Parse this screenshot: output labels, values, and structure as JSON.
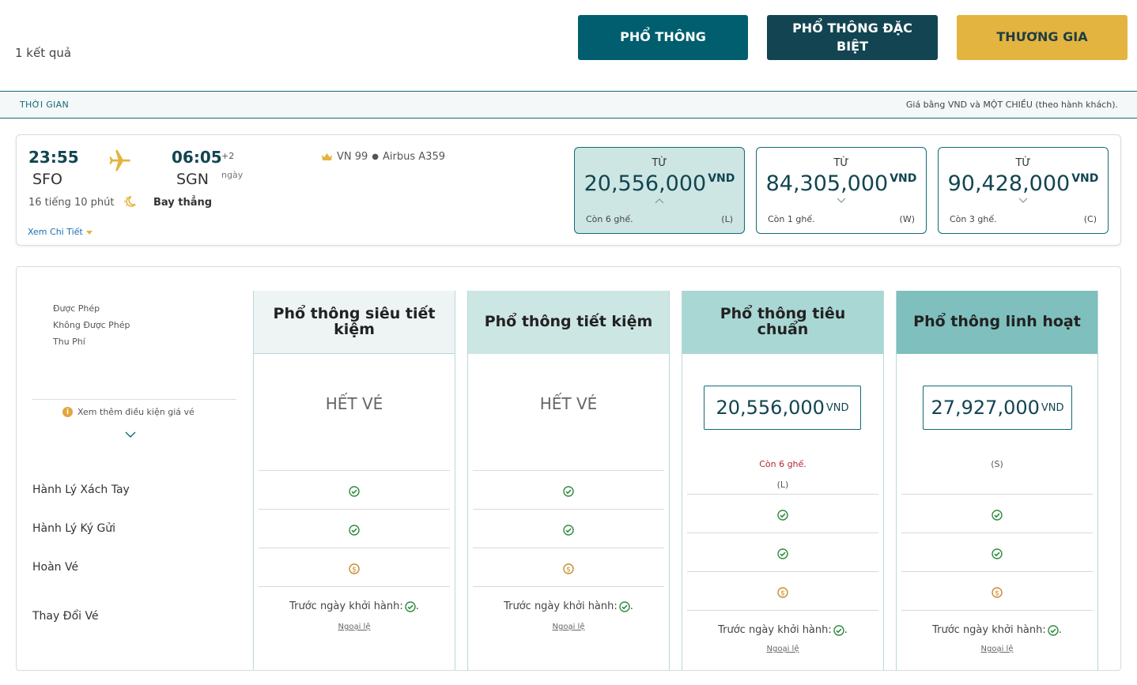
{
  "results": "1 kết quả",
  "cabins": [
    {
      "label": "PHỔ THÔNG"
    },
    {
      "label": "PHỔ THÔNG ĐẶC BIỆT"
    },
    {
      "label": "THƯƠNG GIA"
    }
  ],
  "bar": {
    "time_label": "THỜI GIAN",
    "note": "Giá bằng VND và MỘT CHIỀU (theo hành khách)."
  },
  "flight": {
    "dep_time": "23:55",
    "dep_code": "SFO",
    "arr_time": "06:05",
    "plus_days": "+2",
    "day_label": "ngày",
    "arr_code": "SGN",
    "duration": "16 tiếng 10 phút",
    "nonstop": "Bay thẳng",
    "details_link": "Xem Chi Tiết",
    "flight_no": "VN 99",
    "aircraft": "Airbus A359"
  },
  "fares": [
    {
      "from": "TỪ",
      "price": "20,556,000",
      "currency": "VND",
      "seats": "Còn 6 ghế.",
      "class": "(L)",
      "selected": true
    },
    {
      "from": "TỪ",
      "price": "84,305,000",
      "currency": "VND",
      "seats": "Còn 1 ghế.",
      "class": "(W)",
      "selected": false
    },
    {
      "from": "TỪ",
      "price": "90,428,000",
      "currency": "VND",
      "seats": "Còn 3 ghế.",
      "class": "(C)",
      "selected": false
    }
  ],
  "legend": {
    "allowed": "Được Phép",
    "not_allowed": "Không Được Phép",
    "fee": "Thu Phí"
  },
  "more_conditions": "Xem thêm điều kiện giá vé",
  "row_labels": {
    "carry_on": "Hành Lý Xách Tay",
    "checked": "Hành Lý Ký Gửi",
    "refund": "Hoàn Vé",
    "change": "Thay Đổi Vé"
  },
  "columns": [
    {
      "name": "Phổ thông siêu tiết kiệm",
      "sold_out": "HẾT VÉ",
      "change": "Trước ngày khởi hành:",
      "exception": "Ngoại lệ"
    },
    {
      "name": "Phổ thông tiết kiệm",
      "sold_out": "HẾT VÉ",
      "change": "Trước ngày khởi hành:",
      "exception": "Ngoại lệ"
    },
    {
      "name": "Phổ thông tiêu chuẩn",
      "price": "20,556,000",
      "currency": "VND",
      "seats": "Còn 6 ghế.",
      "class": "(L)",
      "change": "Trước ngày khởi hành:",
      "exception": "Ngoại lệ"
    },
    {
      "name": "Phổ thông linh hoạt",
      "price": "27,927,000",
      "currency": "VND",
      "class": "(S)",
      "change": "Trước ngày khởi hành:",
      "exception": "Ngoại lệ"
    }
  ],
  "colors": {
    "primary": "#005e6e",
    "dark": "#124551",
    "gold": "#e3b43f",
    "check": "#2e8b3d",
    "fee": "#c98b2e"
  }
}
